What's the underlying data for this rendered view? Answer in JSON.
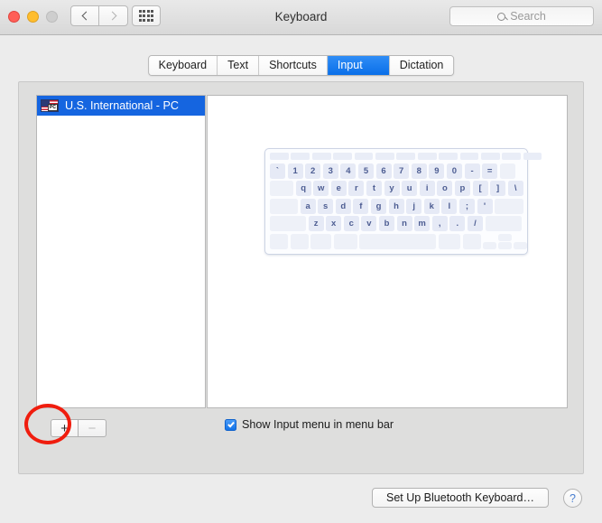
{
  "window": {
    "title": "Keyboard",
    "traffic_lights": [
      "close",
      "minimize",
      "zoom"
    ],
    "back_icon": "chevron-left-icon",
    "forward_icon": "chevron-right-icon",
    "grid_icon": "show-all-grid-icon"
  },
  "search": {
    "placeholder": "Search",
    "value": "",
    "icon": "search-icon"
  },
  "tabs": [
    {
      "label": "Keyboard",
      "active": false
    },
    {
      "label": "Text",
      "active": false
    },
    {
      "label": "Shortcuts",
      "active": false
    },
    {
      "label": "Input Sources",
      "active": true
    },
    {
      "label": "Dictation",
      "active": false
    }
  ],
  "input_sources": {
    "items": [
      {
        "label": "U.S. International - PC",
        "icon": "us-flag-pc-icon",
        "badge": "PC",
        "selected": true
      }
    ],
    "add_label": "+",
    "remove_label": "−",
    "add_enabled": true,
    "remove_enabled": false
  },
  "keyboard_preview": {
    "rows": [
      {
        "type": "function",
        "keys": [
          "",
          "",
          "",
          "",
          "",
          "",
          "",
          "",
          "",
          "",
          "",
          "",
          "",
          ""
        ]
      },
      {
        "type": "normal",
        "keys": [
          "`",
          "1",
          "2",
          "3",
          "4",
          "5",
          "6",
          "7",
          "8",
          "9",
          "0",
          "-",
          "=",
          ""
        ]
      },
      {
        "type": "normal",
        "keys": [
          "",
          "q",
          "w",
          "e",
          "r",
          "t",
          "y",
          "u",
          "i",
          "o",
          "p",
          "[",
          "]",
          "\\"
        ]
      },
      {
        "type": "normal",
        "keys": [
          "",
          "a",
          "s",
          "d",
          "f",
          "g",
          "h",
          "j",
          "k",
          "l",
          ";",
          "'",
          ""
        ]
      },
      {
        "type": "normal",
        "keys": [
          "",
          "z",
          "x",
          "c",
          "v",
          "b",
          "n",
          "m",
          ",",
          ".",
          "/",
          ""
        ]
      },
      {
        "type": "modifier",
        "keys": [
          "",
          "",
          "",
          "",
          "",
          "",
          "",
          "",
          "",
          ""
        ]
      }
    ],
    "key_color": "#e6eaf6",
    "key_text_color": "#4d5d92"
  },
  "options": {
    "show_input_menu": {
      "label": "Show Input menu in menu bar",
      "checked": true
    }
  },
  "footer": {
    "bluetooth_button": "Set Up Bluetooth Keyboard…",
    "help_button": "?"
  },
  "annotation": {
    "shape": "circle",
    "color": "#f01d0e",
    "target": "add-input-source-button"
  },
  "colors": {
    "accent": "#1565e0",
    "tab_active": "#0a6fe8",
    "annotation": "#f01d0e"
  }
}
